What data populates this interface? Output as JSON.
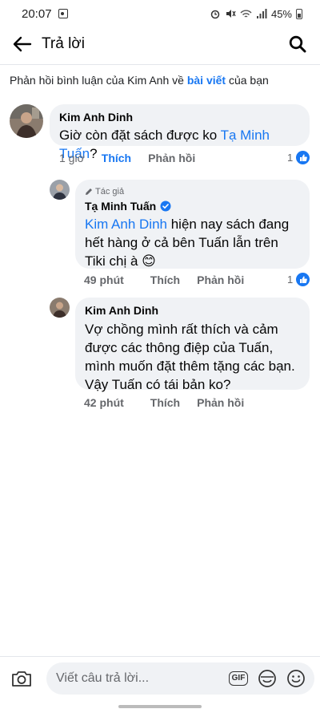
{
  "status_bar": {
    "time": "20:07",
    "battery": "45%"
  },
  "header": {
    "title": "Trả lời"
  },
  "context": {
    "prefix": "Phản hồi bình luận của Kim Anh về ",
    "link": "bài viết",
    "suffix": " của bạn"
  },
  "comments": [
    {
      "author": "Kim Anh Dinh",
      "text_before": "Giờ còn đặt sách được ko ",
      "mention": "Tạ Minh Tuấn",
      "text_after": "?",
      "time": "1 giờ",
      "like_label": "Thích",
      "reply_label": "Phản hồi",
      "reactions": "1"
    },
    {
      "badge": "Tác giả",
      "author": "Tạ Minh Tuấn",
      "mention": "Kim Anh Dinh",
      "text_after": " hiện nay sách đang hết hàng ở cả bên Tuấn lẫn trên Tiki chị à 😊",
      "time": "49 phút",
      "like_label": "Thích",
      "reply_label": "Phản hồi",
      "reactions": "1"
    },
    {
      "author": "Kim Anh Dinh",
      "text": "Vợ chồng mình rất thích và cảm được các thông điệp của Tuấn, mình muốn đặt thêm tặng các bạn. Vậy Tuấn có tái bản ko?",
      "time": "42 phút",
      "like_label": "Thích",
      "reply_label": "Phản hồi"
    }
  ],
  "composer": {
    "placeholder": "Viết câu trả lời...",
    "gif_label": "GIF"
  },
  "colors": {
    "accent": "#1877f2",
    "bubble": "#f0f2f5",
    "muted": "#65676b"
  }
}
